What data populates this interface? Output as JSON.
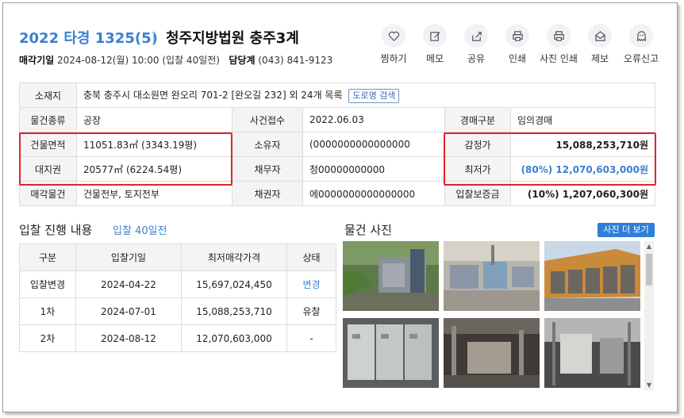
{
  "header": {
    "case_no": "2022 타경 1325(5)",
    "court": "청주지방법원 충주3계",
    "sale_date_label": "매각기일",
    "sale_date": "2024-08-12(월) 10:00 (입찰 40일전)",
    "officer_label": "담당계",
    "officer_phone": "(043) 841-9123"
  },
  "actions": [
    {
      "label": "찜하기",
      "icon": "heart-icon"
    },
    {
      "label": "메모",
      "icon": "memo-icon"
    },
    {
      "label": "공유",
      "icon": "share-icon"
    },
    {
      "label": "인쇄",
      "icon": "print-icon"
    },
    {
      "label": "사진 인쇄",
      "icon": "photo-print-icon"
    },
    {
      "label": "제보",
      "icon": "report-icon"
    },
    {
      "label": "오류신고",
      "icon": "error-report-icon"
    }
  ],
  "info": {
    "location_label": "소재지",
    "location": "충북 충주시 대소원면 완오리 701-2 [완오길 232] 외 24개 목록",
    "road_search": "도로명 검색",
    "type_label": "물건종류",
    "type": "공장",
    "received_label": "사건접수",
    "received": "2022.06.03",
    "auction_type_label": "경매구분",
    "auction_type": "임의경매",
    "building_area_label": "건물면적",
    "building_area": "11051.83㎡ (3343.19평)",
    "owner_label": "소유자",
    "owner": "(0000000000000000",
    "appraisal_label": "감정가",
    "appraisal": "15,088,253,710원",
    "land_label": "대지권",
    "land": "20577㎡ (6224.54평)",
    "debtor_label": "채무자",
    "debtor": "청00000000000",
    "min_price_label": "최저가",
    "min_price": "(80%) 12,070,603,000원",
    "sale_item_label": "매각물건",
    "sale_item": "건물전부, 토지전부",
    "creditor_label": "채권자",
    "creditor": "에0000000000000000",
    "deposit_label": "입찰보증금",
    "deposit": "(10%) 1,207,060,300원"
  },
  "bids": {
    "title": "입찰 진행 내용",
    "subtitle": "입찰 40일전",
    "headers": [
      "구분",
      "입찰기일",
      "최저매각가격",
      "상태"
    ],
    "rows": [
      [
        "입찰변경",
        "2024-04-22",
        "15,697,024,450",
        "변경"
      ],
      [
        "1차",
        "2024-07-01",
        "15,088,253,710",
        "유찰"
      ],
      [
        "2차",
        "2024-08-12",
        "12,070,603,000",
        "-"
      ]
    ]
  },
  "photos": {
    "title": "물건 사진",
    "more": "사진 더 보기"
  },
  "colors": {
    "accent": "#3b7fd0",
    "highlight_box": "#e02424",
    "button": "#2f7fd8"
  }
}
